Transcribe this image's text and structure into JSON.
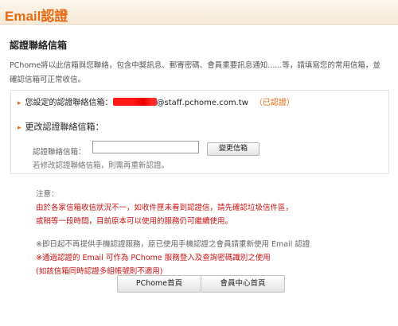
{
  "header": {
    "title": "Email認證"
  },
  "section": {
    "title": "認證聯絡信箱",
    "intro_line1": "PChome將以此信箱與您聯絡，包含中獎訊息、郵寄密碼、會員重要訊息通知......等，請填寫您的常用信箱，並",
    "intro_line2": "確認信箱可正常收信。"
  },
  "current_email": {
    "label": "您設定的認證聯絡信箱：",
    "domain": "@staff.pchome.com.tw",
    "status": "（已認證）"
  },
  "change_email": {
    "title": "更改認證聯絡信箱：",
    "field_label": "認證聯絡信箱：",
    "input_value": "",
    "button": "變更信箱",
    "hint": "若修改認證聯絡信箱，則需再重新認證。"
  },
  "notes": {
    "label": "注意：",
    "line1": "由於各家信箱收信狀況不一，如收件匣未看到認證信，請先確認垃圾信件區，",
    "line2": "或稍等一段時間，目前原本可以使用的服務仍可繼續使用。",
    "line3": "※即日起不再提供手機認證服務，原已使用手機認證之會員請重新使用 Email 認證",
    "line4": "※通過認證的 Email 可作為 PChome 服務登入及查詢密碼識別之使用",
    "line5": "(如該信箱同時認證多組帳號則不適用)"
  },
  "buttons": {
    "home": "PChome首頁",
    "member": "會員中心首頁"
  },
  "colors": {
    "accent": "#e86a12",
    "warning": "#cc1111"
  }
}
